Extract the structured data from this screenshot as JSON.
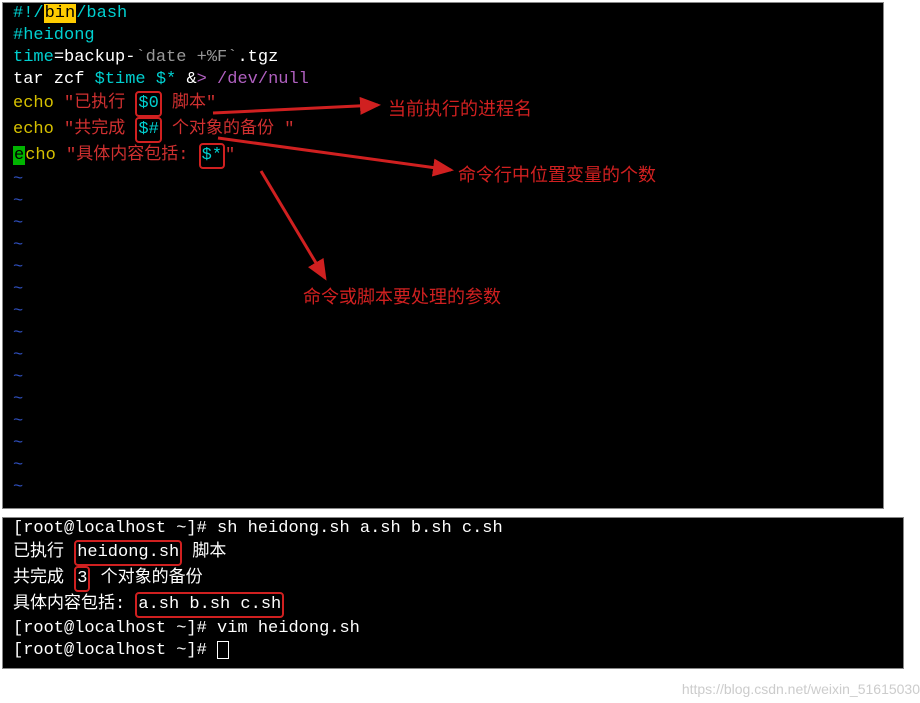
{
  "script": {
    "shebang_prefix": "#!/",
    "shebang_bin": "bin",
    "shebang_bash": "/bash",
    "comment": "#heidong",
    "l3_a": "time",
    "l3_b": "=backup-",
    "l3_c": "`date +%F`",
    "l3_d": ".tgz",
    "l4_a": "tar zcf ",
    "l4_b": "$time $*",
    "l4_c": " &",
    "l4_d": "> /dev/null",
    "l5_a": "echo",
    "l5_b": " \"",
    "l5_c": "已执行 ",
    "l5_var": "$0",
    "l5_d": " 脚本",
    "l5_e": "\"",
    "l6_a": "echo",
    "l6_b": " \"",
    "l6_c": "共完成 ",
    "l6_var": "$#",
    "l6_d": " 个对象的备份 ",
    "l6_e": "\"",
    "l7_e_char": "e",
    "l7_a": "cho",
    "l7_b": " \"",
    "l7_c": "具体内容包括: ",
    "l7_var": "$*",
    "l7_e": "\""
  },
  "annotations": {
    "a1": "当前执行的进程名",
    "a2": "命令行中位置变量的个数",
    "a3": "命令或脚本要处理的参数"
  },
  "output": {
    "prompt1": "[root@localhost ~]# ",
    "cmd1": "sh heidong.sh a.sh b.sh c.sh",
    "r1_a": "已执行 ",
    "r1_box": "heidong.sh",
    "r1_b": " 脚本",
    "r2_a": "共完成 ",
    "r2_box": "3",
    "r2_b": " 个对象的备份",
    "r3_a": "具体内容包括: ",
    "r3_box": "a.sh b.sh c.sh",
    "prompt2": "[root@localhost ~]# ",
    "cmd2": "vim heidong.sh",
    "prompt3": "[root@localhost ~]# "
  },
  "watermark": "https://blog.csdn.net/weixin_51615030"
}
